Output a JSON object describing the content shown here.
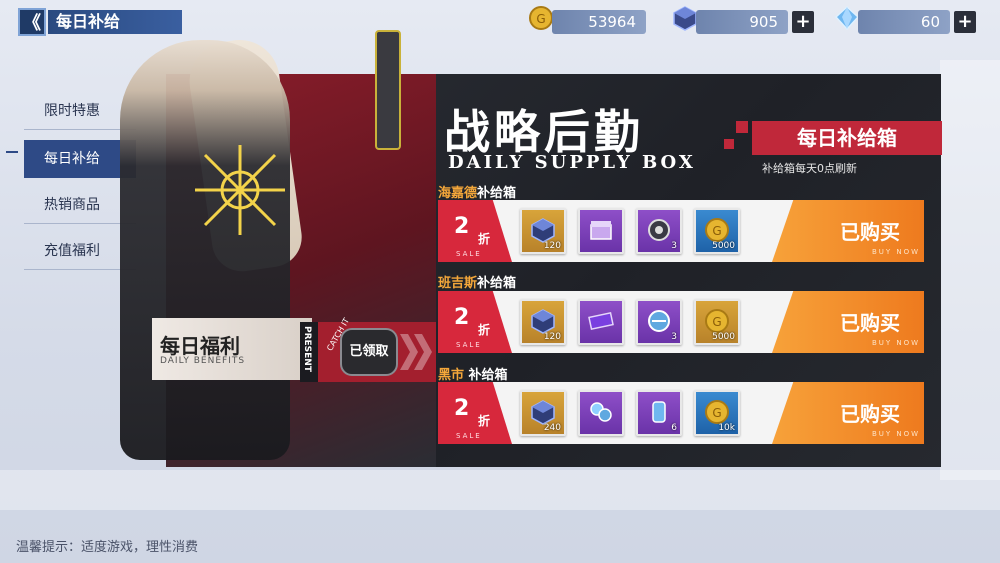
{
  "header": {
    "back_symbol": "《",
    "title": "每日补给"
  },
  "resources": [
    {
      "icon": "gold-coin-icon",
      "value": "53964",
      "has_plus": false
    },
    {
      "icon": "cube-icon",
      "value": "905",
      "has_plus": true
    },
    {
      "icon": "crystal-icon",
      "value": "60",
      "has_plus": true
    }
  ],
  "sidebar": {
    "items": [
      {
        "label": "限时特惠",
        "active": false
      },
      {
        "label": "每日补给",
        "active": true
      },
      {
        "label": "热销商品",
        "active": false
      },
      {
        "label": "充值福利",
        "active": false
      }
    ]
  },
  "banner": {
    "title": "战略后勤",
    "subtitle": "DAILY SUPPLY BOX",
    "badge": "每日补给箱",
    "note": "补给箱每天0点刷新"
  },
  "benefit": {
    "title": "每日福利",
    "subtitle": "DAILY BENEFITS",
    "side": "PRESENT",
    "catch": "CATCH IT",
    "status": "已领取"
  },
  "rows": [
    {
      "name_hl": "海嘉德",
      "name_rest": "补给箱",
      "discount": "2",
      "discount_unit": "折",
      "sale_tag": "SALE",
      "items": [
        {
          "color": "gold",
          "icon": "cube-icon",
          "count": "120"
        },
        {
          "color": "purple",
          "icon": "chest-icon",
          "count": ""
        },
        {
          "color": "purple",
          "icon": "gear-box-icon",
          "count": "3"
        },
        {
          "color": "blue",
          "icon": "gold-coin-icon",
          "count": "5000"
        }
      ],
      "button": "已购买",
      "button_sub": "BUY NOW"
    },
    {
      "name_hl": "班吉斯",
      "name_rest": "补给箱",
      "discount": "2",
      "discount_unit": "折",
      "sale_tag": "SALE",
      "items": [
        {
          "color": "gold",
          "icon": "cube-icon",
          "count": "120"
        },
        {
          "color": "purple",
          "icon": "ticket-icon",
          "count": ""
        },
        {
          "color": "purple",
          "icon": "blueprint-icon",
          "count": "3"
        },
        {
          "color": "gold",
          "icon": "gold-coin-icon",
          "count": "5000"
        }
      ],
      "button": "已购买",
      "button_sub": "BUY NOW"
    },
    {
      "name_hl": "黑市",
      "name_rest": "补给箱",
      "discount": "2",
      "discount_unit": "折",
      "sale_tag": "SALE",
      "items": [
        {
          "color": "gold",
          "icon": "cube-icon",
          "count": "240"
        },
        {
          "color": "purple",
          "icon": "parts-icon",
          "count": ""
        },
        {
          "color": "purple",
          "icon": "canister-icon",
          "count": "6"
        },
        {
          "color": "blue",
          "icon": "gold-coin-icon",
          "count": "10k"
        }
      ],
      "button": "已购买",
      "button_sub": "BUY NOW"
    }
  ],
  "footer": {
    "tip": "温馨提示：适度游戏，理性消费"
  },
  "colors": {
    "accent_red": "#c0283a",
    "buy_orange": "#f29030",
    "nav_blue": "#2e4a86"
  }
}
